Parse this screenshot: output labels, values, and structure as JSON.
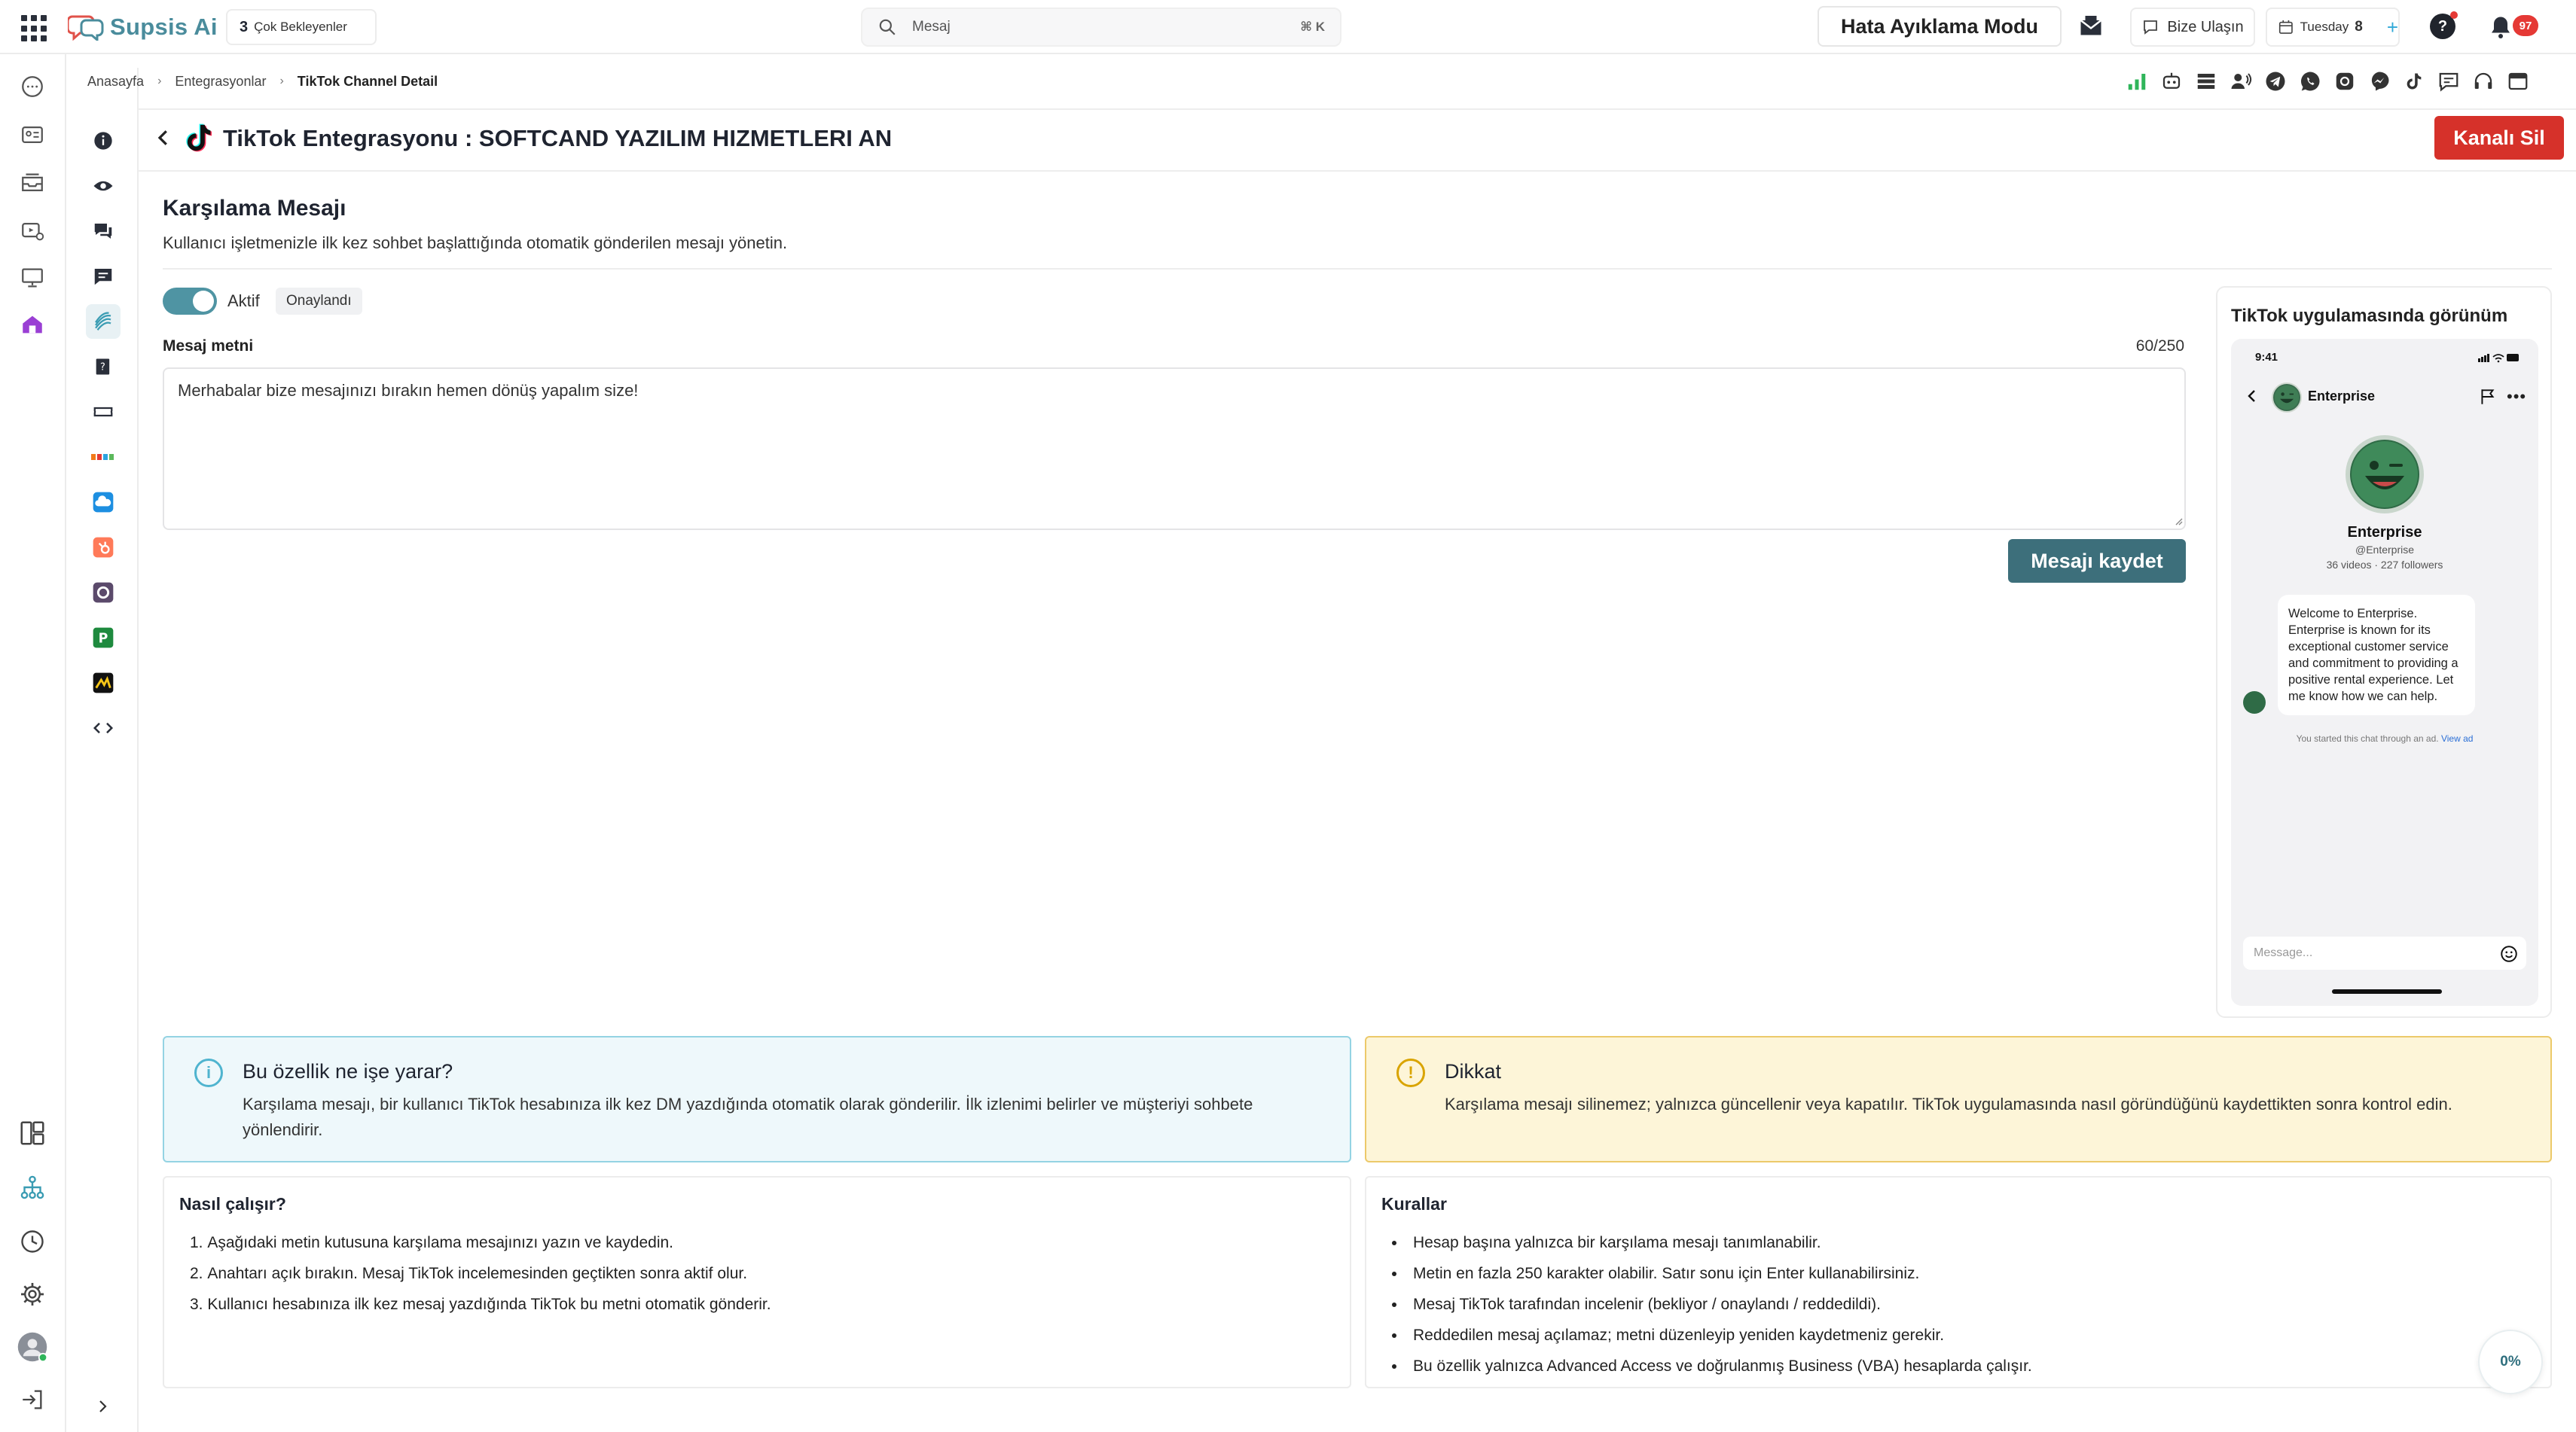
{
  "topbar": {
    "app_name": "Supsis Ai",
    "pending_count": "3",
    "pending_label": "Çok Bekleyenler",
    "search_placeholder": "Mesaj",
    "search_shortcut": "⌘ K",
    "debug_mode_label": "Hata Ayıklama Modu",
    "contact_label": "Bize Ulaşın",
    "date_day": "Tuesday",
    "date_num": "8",
    "date_add": "+",
    "help_label": "?",
    "notification_count": "97"
  },
  "breadcrumb": {
    "home": "Anasayfa",
    "integrations": "Entegrasyonlar",
    "current": "TikTok Channel Detail"
  },
  "page": {
    "title": "TikTok Entegrasyonu : SOFTCAND YAZILIM HIZMETLERI AN",
    "delete_label": "Kanalı Sil"
  },
  "welcome": {
    "title": "Karşılama Mesajı",
    "description": "Kullanıcı işletmenizle ilk kez sohbet başlattığında otomatik gönderilen mesajı yönetin.",
    "toggle_label": "Aktif",
    "toggle_on": true,
    "status": "Onaylandı",
    "field_label": "Mesaj metni",
    "counter": "60/250",
    "message": "Merhabalar bize mesajınızı bırakın hemen dönüş yapalım size!",
    "save_label": "Mesajı kaydet"
  },
  "preview": {
    "title": "TikTok uygulamasında görünüm",
    "time": "9:41",
    "account_name": "Enterprise",
    "handle": "@Enterprise",
    "stats": "36 videos · 227 followers",
    "bubble": "Welcome to Enterprise. Enterprise is known for its exceptional customer service and commitment to providing a positive rental experience. Let me know how we can help.",
    "ad_note": "You started this chat through an ad.",
    "ad_link": "View ad",
    "input_placeholder": "Message..."
  },
  "info": {
    "title": "Bu özellik ne işe yarar?",
    "text": "Karşılama mesajı, bir kullanıcı TikTok hesabınıza ilk kez DM yazdığında otomatik olarak gönderilir. İlk izlenimi belirler ve müşteriyi sohbete yönlendirir.",
    "icon_glyph": "i"
  },
  "warning": {
    "title": "Dikkat",
    "text": "Karşılama mesajı silinemez; yalnızca güncellenir veya kapatılır. TikTok uygulamasında nasıl göründüğünü kaydettikten sonra kontrol edin.",
    "icon_glyph": "!"
  },
  "how": {
    "title": "Nasıl çalışır?",
    "steps": [
      "Aşağıdaki metin kutusuna karşılama mesajınızı yazın ve kaydedin.",
      "Anahtarı açık bırakın. Mesaj TikTok incelemesinden geçtikten sonra aktif olur.",
      "Kullanıcı hesabınıza ilk kez mesaj yazdığında TikTok bu metni otomatik gönderir."
    ]
  },
  "rules": {
    "title": "Kurallar",
    "items": [
      "Hesap başına yalnızca bir karşılama mesajı tanımlanabilir.",
      "Metin en fazla 250 karakter olabilir. Satır sonu için Enter kullanabilirsiniz.",
      "Mesaj TikTok tarafından incelenir (bekliyor / onaylandı / reddedildi).",
      "Reddedilen mesaj açılamaz; metni düzenleyip yeniden kaydetmeniz gerekir.",
      "Bu özellik yalnızca Advanced Access ve doğrulanmış Business (VBA) hesaplarda çalışır."
    ]
  },
  "progress": {
    "value": 0,
    "label": "0%"
  },
  "colors": {
    "brand": "#4a8c9c",
    "primary_button": "#3d6f7b",
    "danger": "#d6312a",
    "toggle_on": "#4f94a3",
    "info_bg": "#eef8fb",
    "warning_bg": "#fdf5d8"
  },
  "icons": {
    "rail": [
      "chat-icon",
      "contact-card-icon",
      "inbox-icon",
      "media-settings-icon",
      "monitor-icon",
      "home-icon",
      "dashboard-icon",
      "org-tree-icon",
      "clock-icon",
      "settings-icon",
      "avatar",
      "logout-icon"
    ],
    "sidebar": [
      "info-icon",
      "eye-icon",
      "chats-icon",
      "message-icon",
      "tiktok-integration-icon",
      "help-book-icon",
      "ticket-icon",
      "trendyol-icon",
      "cloud-icon",
      "hubspot-icon",
      "circle-app-icon",
      "p-app-icon",
      "bar-app-icon",
      "code-icon"
    ],
    "channels": [
      "signal-icon",
      "bot-icon",
      "list-icon",
      "voice-icon",
      "telegram-icon",
      "whatsapp-icon",
      "instagram-icon",
      "messenger-icon",
      "tiktok-icon",
      "sms-icon",
      "headset-icon",
      "window-icon"
    ]
  }
}
